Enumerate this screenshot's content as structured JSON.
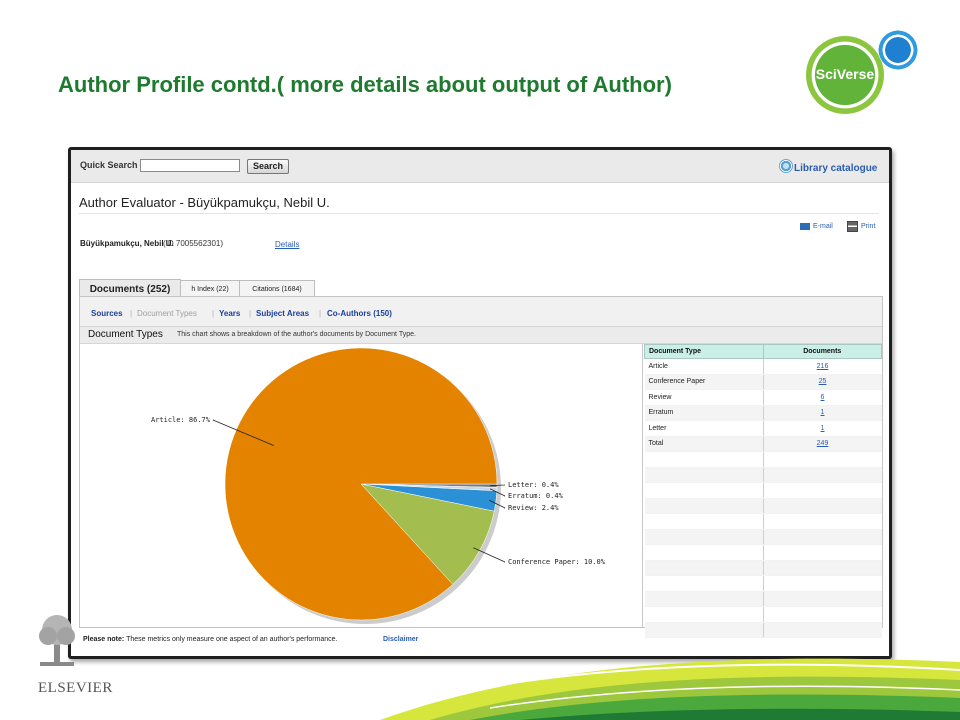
{
  "slide": {
    "title": "Author Profile contd.( more details about output of Author)",
    "logo_text": "SciVerse",
    "publisher": "ELSEVIER"
  },
  "header": {
    "quick_search_label": "Quick Search",
    "search_value": "",
    "search_button": "Search",
    "library_link": "Library catalogue"
  },
  "page": {
    "title": "Author Evaluator - Büyükpamukçu, Nebil U.",
    "email_label": "E-mail",
    "print_label": "Print",
    "author_name": "Büyükpamukçu, Nebil U.",
    "author_id": "(ID 7005562301)",
    "details_link": "Details"
  },
  "tabs": [
    {
      "label": "Documents (252)",
      "active": true
    },
    {
      "label": "h Index (22)",
      "active": false
    },
    {
      "label": "Citations (1684)",
      "active": false
    }
  ],
  "subnav": [
    {
      "label": "Sources",
      "active": true
    },
    {
      "label": "Document Types",
      "active": false
    },
    {
      "label": "Years",
      "active": true
    },
    {
      "label": "Subject Areas",
      "active": true
    },
    {
      "label": "Co-Authors (150)",
      "active": true
    }
  ],
  "section": {
    "title": "Document Types",
    "description": "This chart shows a breakdown of the author's documents by Document Type."
  },
  "table": {
    "headers": [
      "Document Type",
      "Documents"
    ],
    "rows": [
      {
        "type": "Article",
        "count": "216"
      },
      {
        "type": "Conference Paper",
        "count": "25"
      },
      {
        "type": "Review",
        "count": "6"
      },
      {
        "type": "Erratum",
        "count": "1"
      },
      {
        "type": "Letter",
        "count": "1"
      },
      {
        "type": "Total",
        "count": "249"
      }
    ]
  },
  "footer": {
    "note_label": "Please note:",
    "note_text": "These metrics only measure one aspect of an author's performance.",
    "disclaimer": "Disclaimer"
  },
  "chart_data": {
    "type": "pie",
    "title": "",
    "slices": [
      {
        "label": "Article: 86.7%",
        "value": 86.7,
        "color": "#e38300"
      },
      {
        "label": "Conference Paper: 10.0%",
        "value": 10.0,
        "color": "#a3be4e"
      },
      {
        "label": "Review: 2.4%",
        "value": 2.4,
        "color": "#2b90d6"
      },
      {
        "label": "Erratum: 0.4%",
        "value": 0.4,
        "color": "#c9d6e4"
      },
      {
        "label": "Letter: 0.4%",
        "value": 0.4,
        "color": "#7a7a7a"
      }
    ]
  },
  "colors": {
    "title_green": "#1e7a2e",
    "link_blue": "#2a5db0",
    "table_header": "#c9efe6"
  }
}
